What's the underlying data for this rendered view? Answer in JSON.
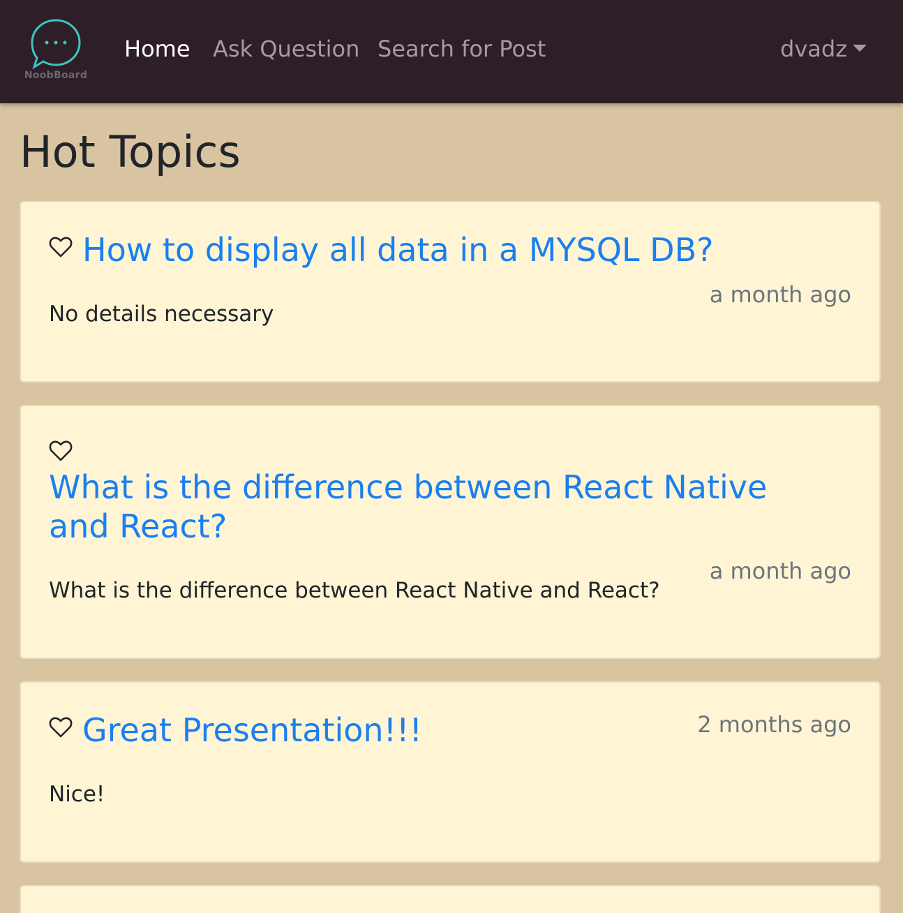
{
  "navbar": {
    "logo_text": "NoobBoard",
    "links": [
      "Home",
      "Ask Question",
      "Search for Post"
    ],
    "user": "dvadz"
  },
  "page": {
    "title": "Hot Topics"
  },
  "posts": [
    {
      "title": "How to display all data in a MYSQL DB?",
      "time": "a month ago",
      "body": "No details necessary"
    },
    {
      "title": "What is the difference between React Native and React?",
      "time": "a month ago",
      "body": "What is the difference between React Native and React?"
    },
    {
      "title": "Great Presentation!!!",
      "time": "2 months ago",
      "body": "Nice!"
    }
  ],
  "colors": {
    "navbar": "#2e1e28",
    "background": "#d9c4a2",
    "card": "#fff5d5",
    "link": "#1a7ff0",
    "logo_accent": "#3cc6c0"
  },
  "icons": [
    "chat-bubble-logo-icon",
    "heart-icon",
    "caret-down-icon"
  ]
}
